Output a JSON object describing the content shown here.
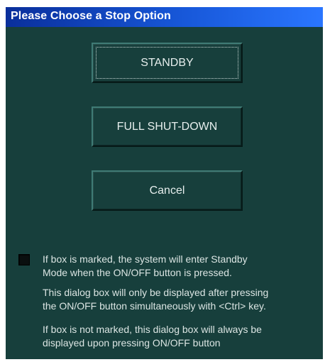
{
  "dialog": {
    "title": "Please Choose a Stop Option",
    "buttons": {
      "standby": "STANDBY",
      "full_shutdown": "FULL SHUT-DOWN",
      "cancel": "Cancel"
    },
    "checkbox": {
      "checked": false,
      "label": "If box is marked, the system will enter Standby\nMode when the ON/OFF button is pressed."
    },
    "info_1": "This dialog box will only be displayed after pressing\nthe ON/OFF button simultaneously with <Ctrl> key.",
    "info_2": "If box is not marked, this dialog box will always be\ndisplayed upon pressing ON/OFF button"
  }
}
